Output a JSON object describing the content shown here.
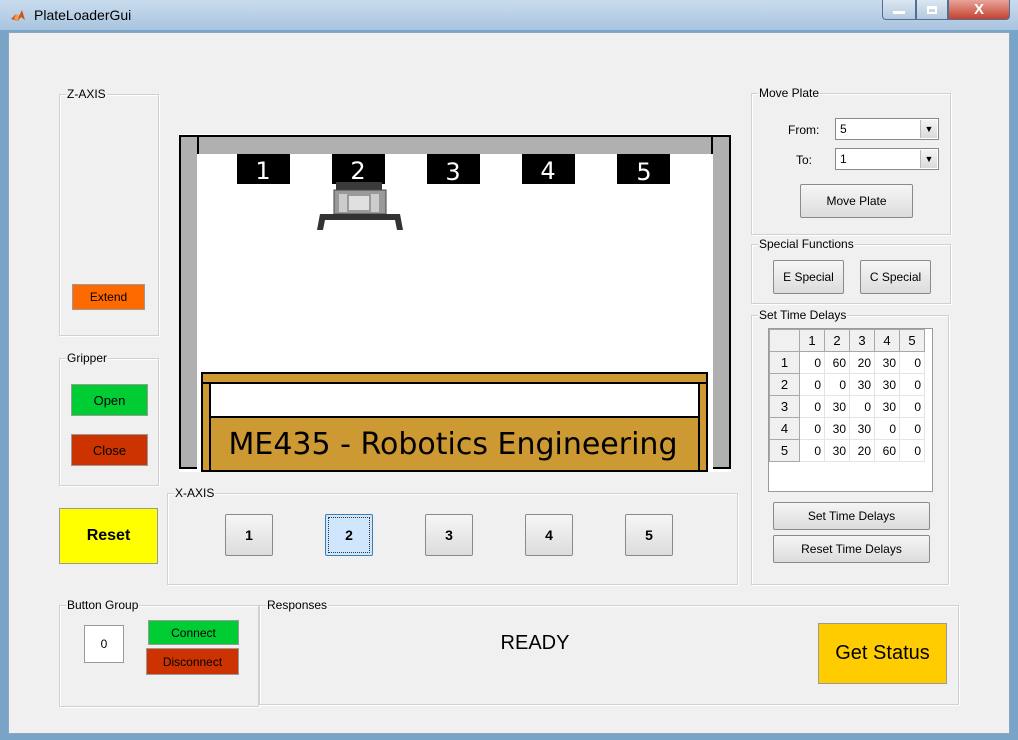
{
  "window": {
    "title": "PlateLoaderGui",
    "close_glyph": "X"
  },
  "z_axis": {
    "title": "Z-AXIS",
    "extend_label": "Extend"
  },
  "gripper": {
    "title": "Gripper",
    "open_label": "Open",
    "close_label": "Close"
  },
  "reset": {
    "label": "Reset"
  },
  "scene": {
    "slot_labels": [
      "1",
      "2",
      "3",
      "4",
      "5"
    ],
    "banner": "ME435 - Robotics Engineering",
    "gripper_position": "2"
  },
  "x_axis": {
    "title": "X-AXIS",
    "buttons": [
      "1",
      "2",
      "3",
      "4",
      "5"
    ],
    "selected": "2"
  },
  "move_plate": {
    "title": "Move Plate",
    "from_label": "From:",
    "from_value": "5",
    "to_label": "To:",
    "to_value": "1",
    "button_label": "Move Plate"
  },
  "special": {
    "title": "Special Functions",
    "e_label": "E Special",
    "c_label": "C Special"
  },
  "time_delays": {
    "title": "Set Time Delays",
    "columns": [
      "1",
      "2",
      "3",
      "4",
      "5"
    ],
    "rows": [
      {
        "label": "1",
        "values": [
          "0",
          "60",
          "20",
          "30",
          "0"
        ]
      },
      {
        "label": "2",
        "values": [
          "0",
          "0",
          "30",
          "30",
          "0"
        ]
      },
      {
        "label": "3",
        "values": [
          "0",
          "30",
          "0",
          "30",
          "0"
        ]
      },
      {
        "label": "4",
        "values": [
          "0",
          "30",
          "30",
          "0",
          "0"
        ]
      },
      {
        "label": "5",
        "values": [
          "0",
          "30",
          "20",
          "60",
          "0"
        ]
      }
    ],
    "set_label": "Set Time Delays",
    "reset_label": "Reset Time Delays"
  },
  "button_group": {
    "title": "Button Group",
    "port_value": "0",
    "connect_label": "Connect",
    "disconnect_label": "Disconnect"
  },
  "responses": {
    "title": "Responses",
    "status_text": "READY",
    "get_status_label": "Get Status"
  },
  "colors": {
    "extend": "#ff6a00",
    "open": "#00cc33",
    "close": "#cc3300",
    "reset": "#ffff00",
    "get_status": "#ffcc00",
    "selected_button": "#cfe6fc"
  }
}
